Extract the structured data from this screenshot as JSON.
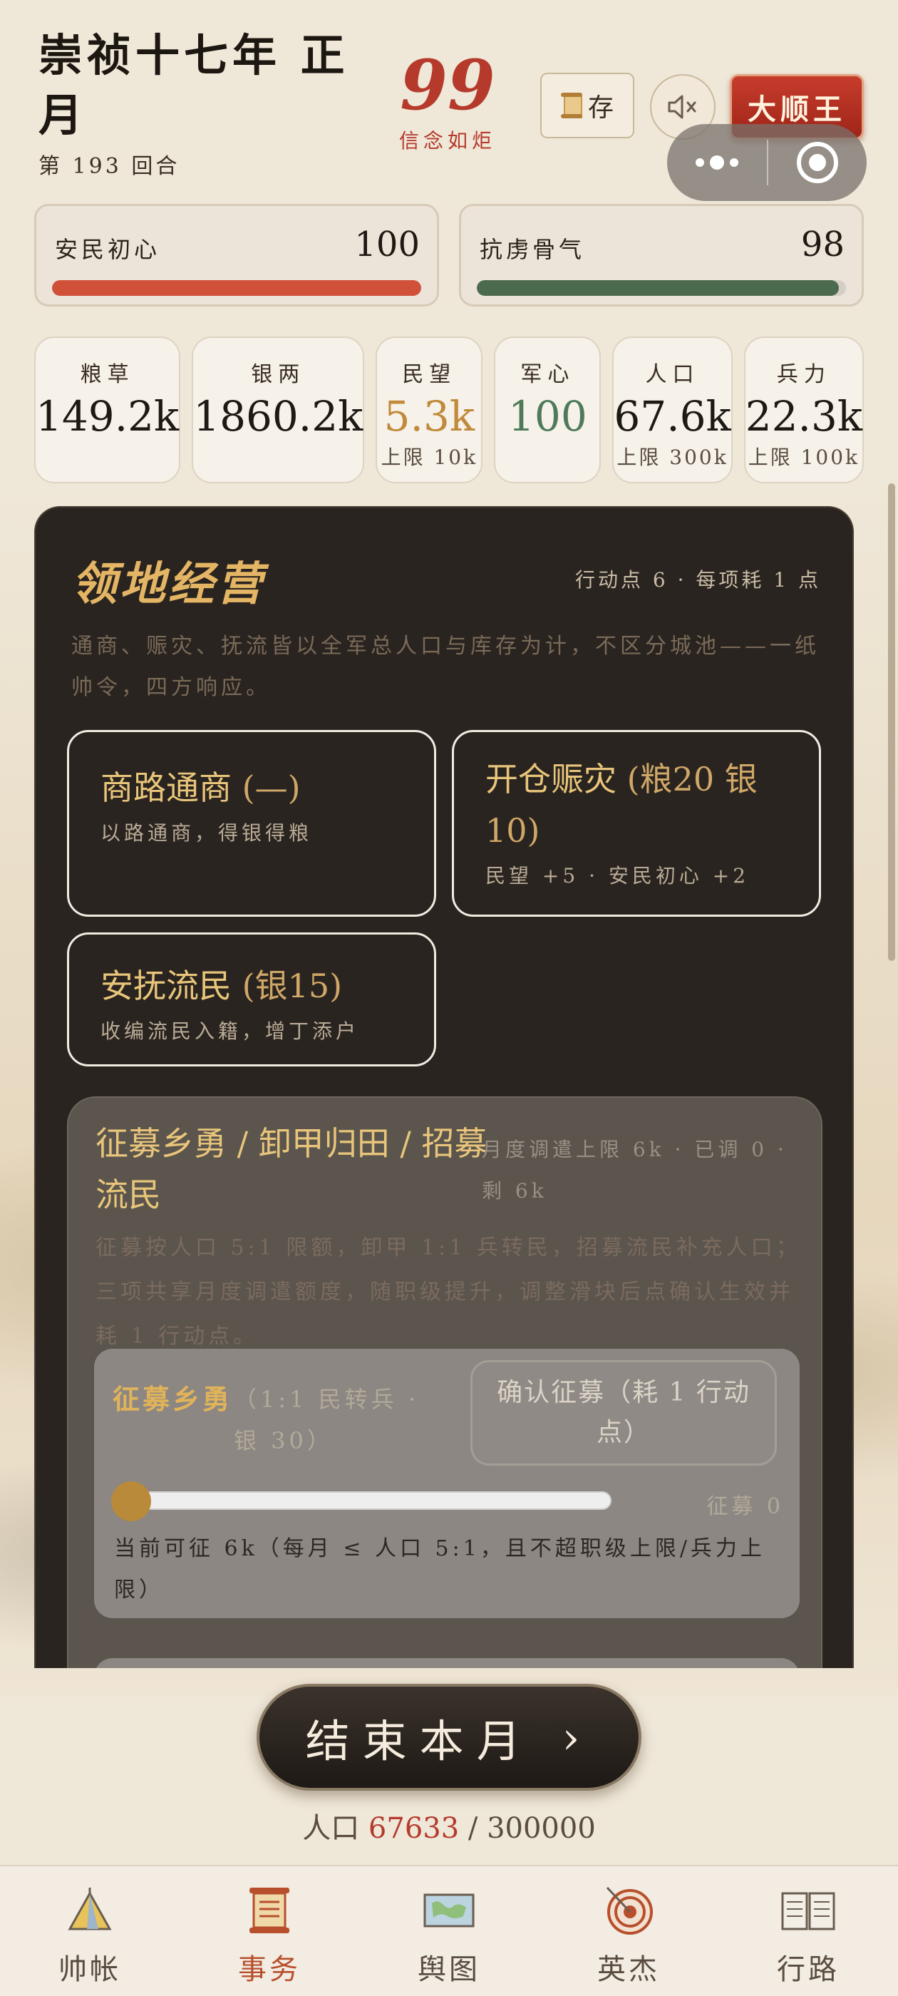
{
  "header": {
    "era_title": "崇祯十七年 正月",
    "turn": "第 193 回合",
    "faith_value": "99",
    "faith_label": "信念如炬",
    "save_label": "存",
    "king_label": "大顺王"
  },
  "meters": [
    {
      "label": "安民初心",
      "value": "100",
      "level": 1.0,
      "color": "#d0503a"
    },
    {
      "label": "抗虏骨气",
      "value": "98",
      "level": 0.98,
      "color": "#4c6a4e"
    }
  ],
  "stats": [
    {
      "label": "粮草",
      "value": "149.2k",
      "cap": ""
    },
    {
      "label": "银两",
      "value": "1860.2k",
      "cap": ""
    },
    {
      "label": "民望",
      "value": "5.3k",
      "cap": "上限 10k",
      "color": "#c08a3a"
    },
    {
      "label": "军心",
      "value": "100",
      "cap": "",
      "color": "#4e7a5a"
    },
    {
      "label": "人口",
      "value": "67.6k",
      "cap": "上限 300k"
    },
    {
      "label": "兵力",
      "value": "22.3k",
      "cap": "上限 100k"
    }
  ],
  "panel": {
    "title": "领地经营",
    "action_points": "行动点 6 · 每项耗 1 点",
    "description": "通商、赈灾、抚流皆以全军总人口与库存为计，不区分城池——一纸帅令，四方响应。",
    "actions": [
      {
        "name": "商路通商",
        "cost": "(—)",
        "desc": "以路通商，得银得粮"
      },
      {
        "name": "开仓赈灾",
        "cost": "(粮20 银10)",
        "desc": "民望 +5 · 安民初心 +2"
      },
      {
        "name": "安抚流民",
        "cost": "(银15)",
        "desc": "收编流民入籍，增丁添户"
      }
    ],
    "recruit": {
      "title": "征募乡勇 / 卸甲归田 / 招募流民",
      "cap": "月度调遣上限 6k · 已调 0 · 剩 6k",
      "description": "征募按人口 5:1 限额，卸甲 1:1 兵转民，招募流民补充人口；三项共享月度调遣额度，随职级提升，调整滑块后点确认生效并耗 1 行动点。",
      "card_title": "征募乡勇",
      "card_note": "（1:1 民转兵 · 银 30）",
      "confirm_label": "确认征募（耗 1 行动点）",
      "slider_value": "征募 0",
      "slider_level": 0,
      "hint": "当前可征 6k（每月 ≤ 人口 5:1，且不超职级上限/兵力上限）"
    }
  },
  "end_turn": {
    "label": "结束本月",
    "arrow": "›"
  },
  "population": {
    "prefix": "人口 ",
    "current": "67633",
    "separator": " / ",
    "max": "300000"
  },
  "nav": [
    {
      "label": "帅帐",
      "icon": "tent-icon"
    },
    {
      "label": "事务",
      "icon": "scroll-icon",
      "active": true
    },
    {
      "label": "舆图",
      "icon": "map-icon"
    },
    {
      "label": "英杰",
      "icon": "target-icon"
    },
    {
      "label": "行路",
      "icon": "book-icon"
    }
  ]
}
